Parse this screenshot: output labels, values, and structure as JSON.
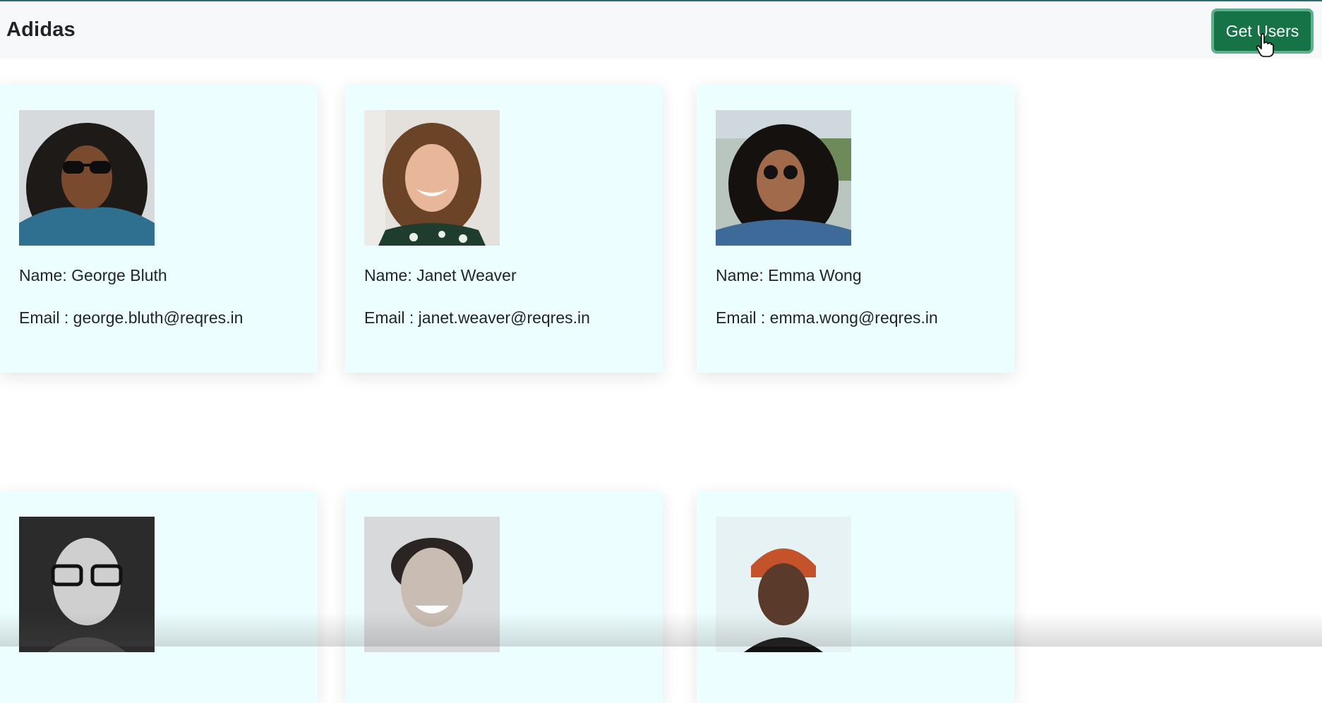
{
  "navbar": {
    "brand": "Adidas",
    "get_users_label": "Get Users"
  },
  "users": [
    {
      "name": "Name: George Bluth",
      "email": "Email : george.bluth@reqres.in"
    },
    {
      "name": "Name: Janet Weaver",
      "email": "Email : janet.weaver@reqres.in"
    },
    {
      "name": "Name: Emma Wong",
      "email": "Email : emma.wong@reqres.in"
    },
    {
      "name": "",
      "email": ""
    },
    {
      "name": "",
      "email": ""
    },
    {
      "name": "",
      "email": ""
    }
  ],
  "colors": {
    "card_bg": "#ecfeff",
    "button_bg": "#157347",
    "navbar_bg": "#f7f8f9"
  }
}
